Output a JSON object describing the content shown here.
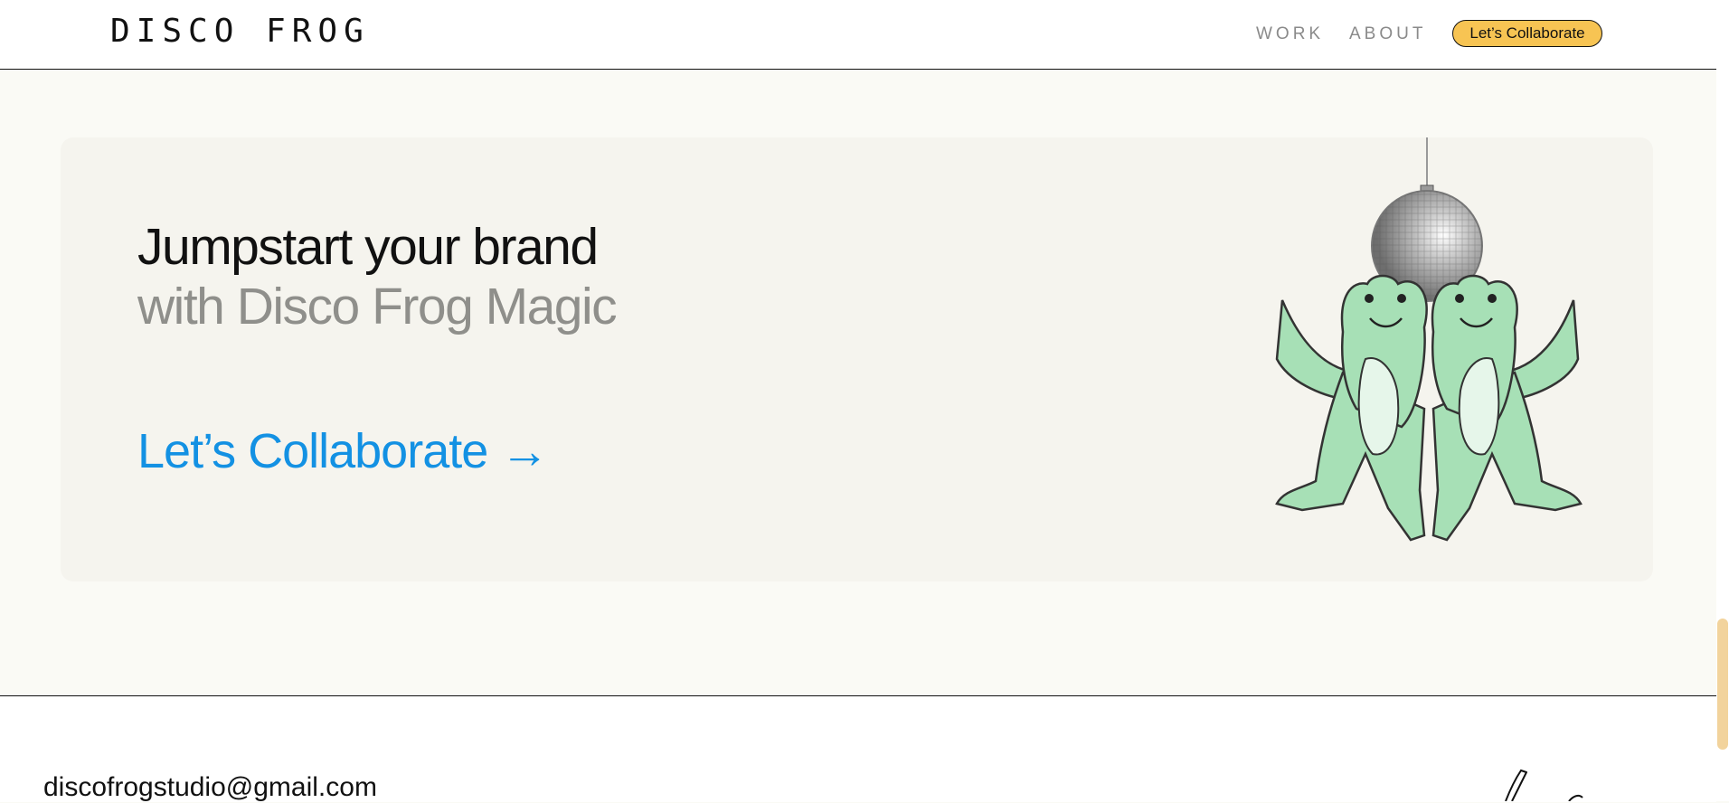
{
  "header": {
    "logo": "DISCO FROG",
    "nav": {
      "work": "WORK",
      "about": "ABOUT",
      "cta": "Let’s Collaborate"
    }
  },
  "hero": {
    "headline": "Jumpstart your brand",
    "subheadline": "with Disco Frog Magic",
    "cta": "Let’s Collaborate →"
  },
  "footer": {
    "email": "discofrogstudio@gmail.com"
  },
  "colors": {
    "accent": "#1391e3",
    "button": "#f7c453",
    "frog": "#a7e0b6",
    "background": "#fafaf5",
    "card": "#f5f4ee"
  }
}
